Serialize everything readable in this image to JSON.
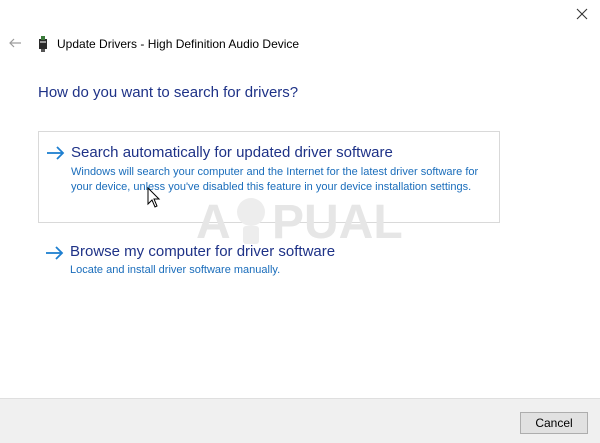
{
  "window": {
    "title": "Update Drivers - High Definition Audio Device",
    "icons": {
      "back": "back-arrow-icon",
      "close": "close-icon",
      "device": "audio-device-icon"
    }
  },
  "main": {
    "heading": "How do you want to search for drivers?",
    "options": [
      {
        "title": "Search automatically for updated driver software",
        "description": "Windows will search your computer and the Internet for the latest driver software for your device, unless you've disabled this feature in your device installation settings.",
        "selected": true
      },
      {
        "title": "Browse my computer for driver software",
        "description": "Locate and install driver software manually.",
        "selected": false
      }
    ]
  },
  "footer": {
    "cancel_label": "Cancel"
  },
  "watermark": {
    "text": "APPUALS"
  },
  "colors": {
    "heading": "#1e3287",
    "link_title": "#1e3287",
    "link_desc": "#1a6dbb",
    "arrow": "#1e7fd0",
    "footer_bg": "#f0f0f0"
  }
}
